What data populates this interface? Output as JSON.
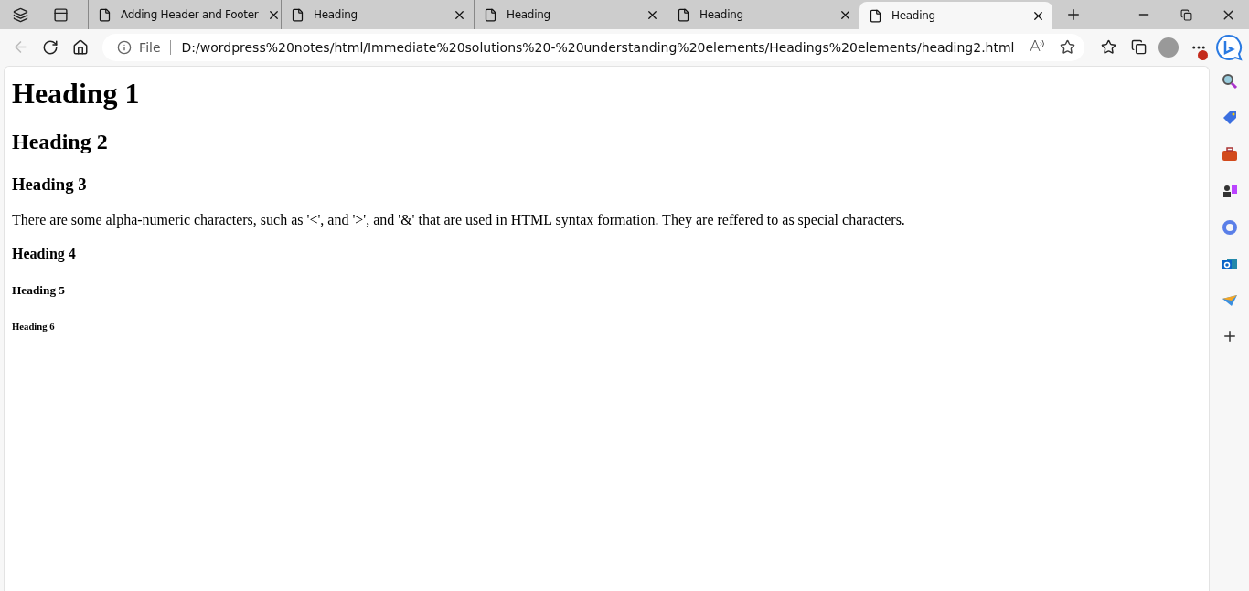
{
  "tabs": [
    {
      "label": "Adding Header and Footer",
      "selected": false
    },
    {
      "label": "Heading",
      "selected": false
    },
    {
      "label": "Heading",
      "selected": false
    },
    {
      "label": "Heading",
      "selected": false
    },
    {
      "label": "Heading",
      "selected": true
    }
  ],
  "address_bar": {
    "scheme": "File",
    "url": "D:/wordpress%20notes/html/Immediate%20solutions%20-%20understanding%20elements/Headings%20elements/heading2.html"
  },
  "page": [
    {
      "kind": "h1",
      "text": "Heading 1"
    },
    {
      "kind": "h2",
      "text": "Heading 2"
    },
    {
      "kind": "h3",
      "text": "Heading 3"
    },
    {
      "kind": "p",
      "text": "There are some alpha-numeric characters, such as '<', and '>', and '&' that are used in HTML syntax formation. They are reffered to as special characters."
    },
    {
      "kind": "h4",
      "text": "Heading 4"
    },
    {
      "kind": "h5",
      "text": "Heading 5"
    },
    {
      "kind": "h6",
      "text": "Heading 6"
    }
  ]
}
